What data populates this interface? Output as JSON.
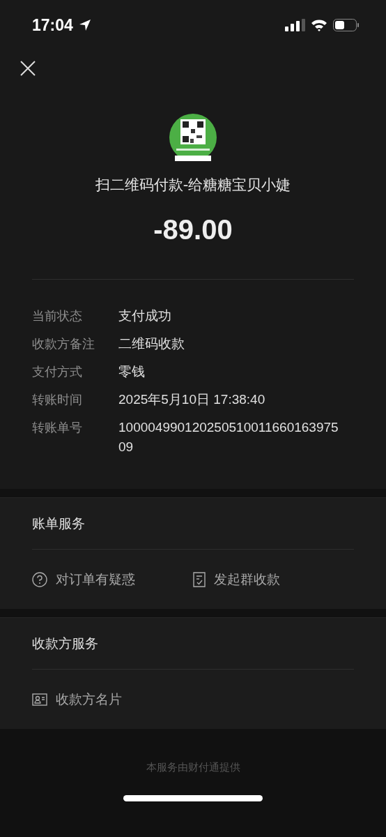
{
  "status_bar": {
    "time": "17:04"
  },
  "header": {
    "title": "扫二维码付款-给糖糖宝贝小婕",
    "amount": "-89.00"
  },
  "details": [
    {
      "label": "当前状态",
      "value": "支付成功"
    },
    {
      "label": "收款方备注",
      "value": "二维码收款"
    },
    {
      "label": "支付方式",
      "value": "零钱"
    },
    {
      "label": "转账时间",
      "value": "2025年5月10日 17:38:40"
    },
    {
      "label": "转账单号",
      "value": "10000499012025051001166016397509"
    }
  ],
  "sections": [
    {
      "title": "账单服务",
      "items": [
        {
          "kind": "question",
          "label": "对订单有疑惑"
        },
        {
          "kind": "receipt",
          "label": "发起群收款"
        }
      ]
    },
    {
      "title": "收款方服务",
      "items": [
        {
          "kind": "card",
          "label": "收款方名片"
        }
      ]
    }
  ],
  "footer": "本服务由财付通提供"
}
